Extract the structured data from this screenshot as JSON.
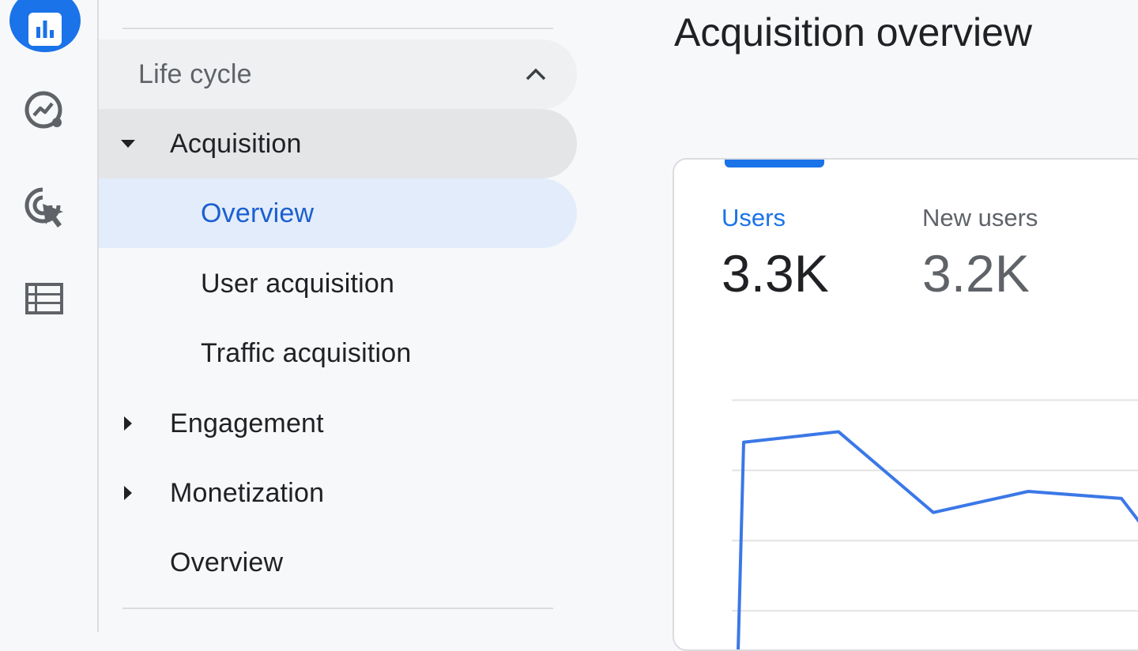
{
  "nav": {
    "section_title": "Life cycle",
    "items": [
      {
        "label": "Acquisition"
      },
      {
        "label": "Overview"
      },
      {
        "label": "User acquisition"
      },
      {
        "label": "Traffic acquisition"
      },
      {
        "label": "Engagement"
      },
      {
        "label": "Monetization"
      },
      {
        "label": "Overview"
      }
    ]
  },
  "rail": {
    "icons": [
      "reports-icon",
      "explore-icon",
      "advertising-icon",
      "configure-icon"
    ]
  },
  "main": {
    "title": "Acquisition overview",
    "metrics": [
      {
        "label": "Users",
        "value": "3.3K"
      },
      {
        "label": "New users",
        "value": "3.2K"
      }
    ]
  },
  "colors": {
    "accent": "#1a73e8",
    "selected_bg": "#e3ecfb",
    "line": "#3b78e7"
  },
  "chart_data": {
    "type": "line",
    "series": [
      {
        "values": [
          0,
          3400,
          3550,
          2400,
          2700,
          2600,
          2100
        ]
      }
    ],
    "ylim": [
      0,
      4500
    ],
    "grid": true
  }
}
